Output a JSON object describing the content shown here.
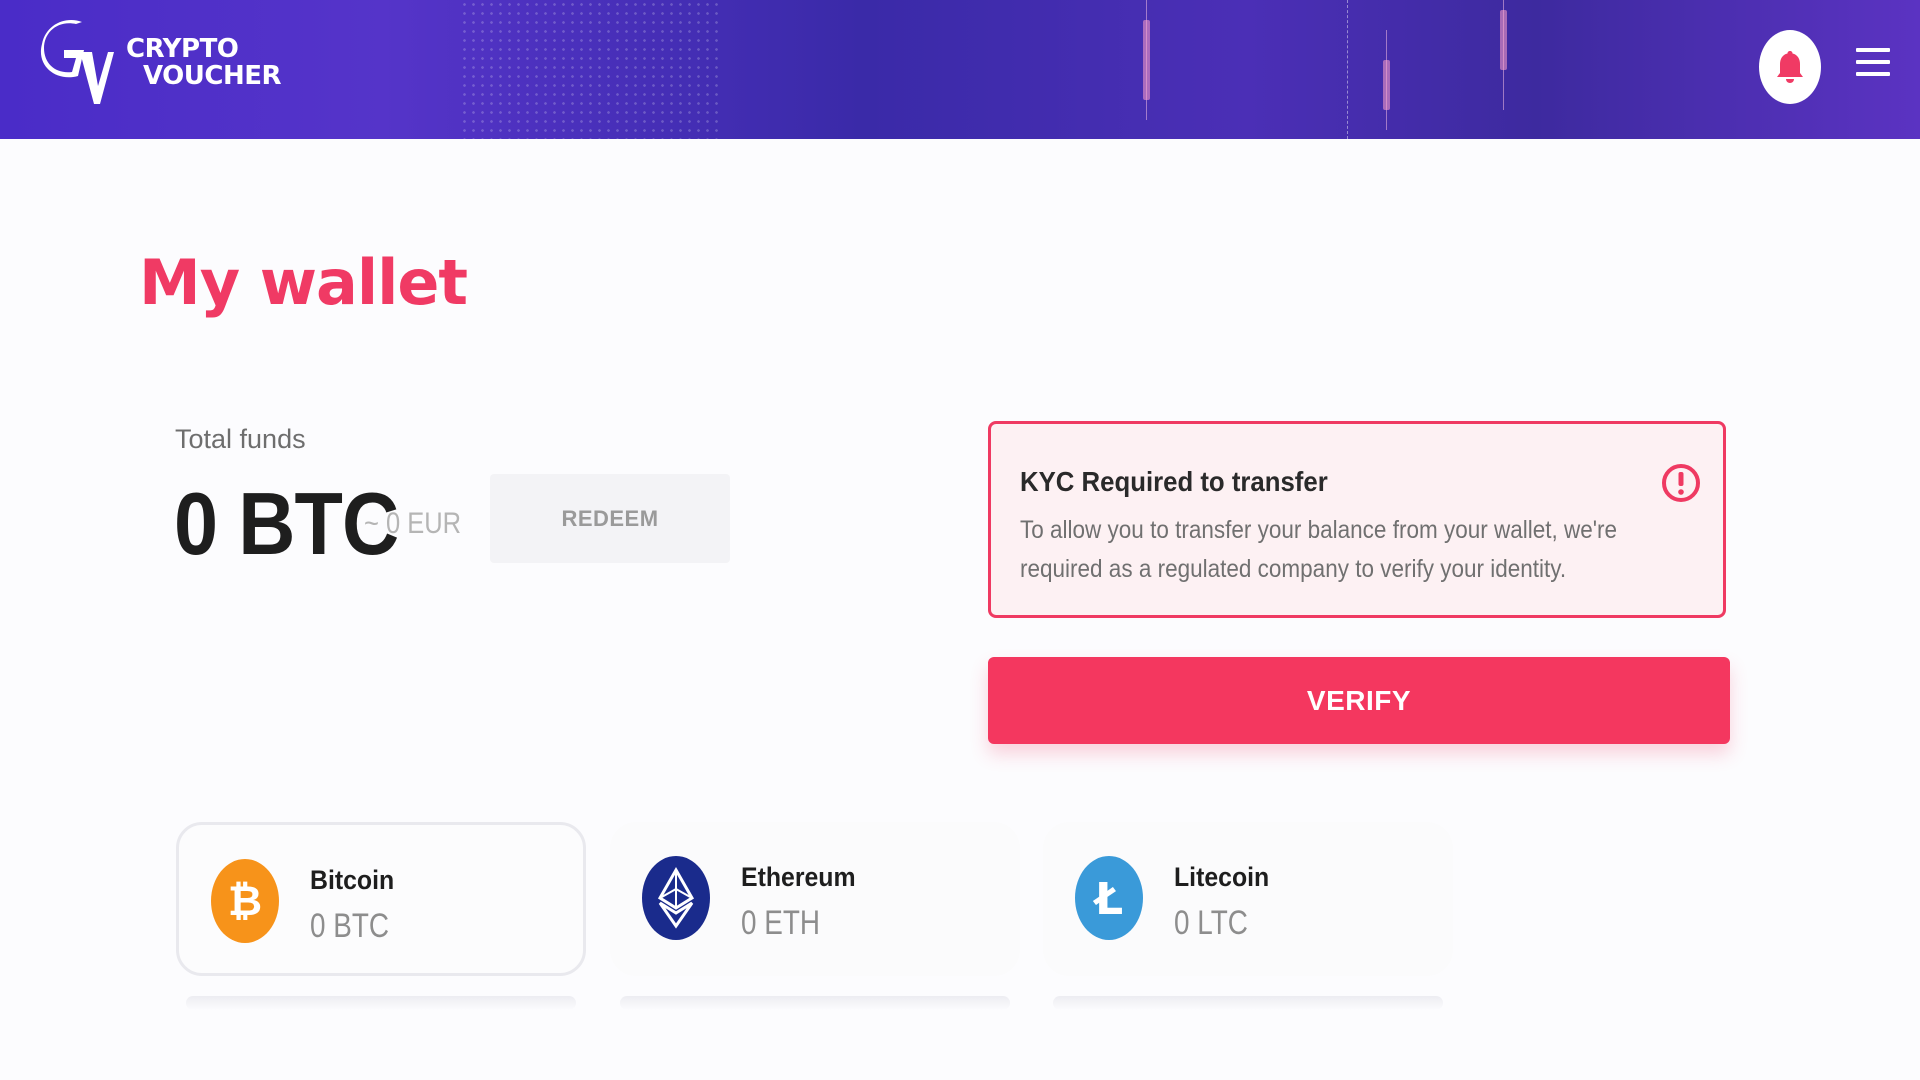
{
  "brand": {
    "line1": "CRYPTO",
    "line2": "VOUCHER",
    "colors": {
      "header": "#4a2cc8",
      "accent": "#f03a64"
    }
  },
  "header": {
    "notification_icon": "bell-icon",
    "menu_icon": "hamburger-menu-icon"
  },
  "page": {
    "title": "My wallet"
  },
  "funds": {
    "label": "Total funds",
    "value": "0 BTC",
    "eur": "~ 0 EUR",
    "redeem_label": "REDEEM"
  },
  "kyc": {
    "title": "KYC Required to transfer",
    "text": "To allow you to transfer your balance from your wallet, we're required as a regulated company to verify your identity.",
    "icon": "alert-circle-icon",
    "verify_label": "VERIFY"
  },
  "coins": [
    {
      "name": "Bitcoin",
      "balance": "0 BTC",
      "icon": "bitcoin-icon",
      "color": "#f7931a",
      "selected": true
    },
    {
      "name": "Ethereum",
      "balance": "0 ETH",
      "icon": "ethereum-icon",
      "color": "#1a2b8c",
      "selected": false
    },
    {
      "name": "Litecoin",
      "balance": "0 LTC",
      "icon": "litecoin-icon",
      "color": "#3a9ad9",
      "selected": false
    }
  ]
}
